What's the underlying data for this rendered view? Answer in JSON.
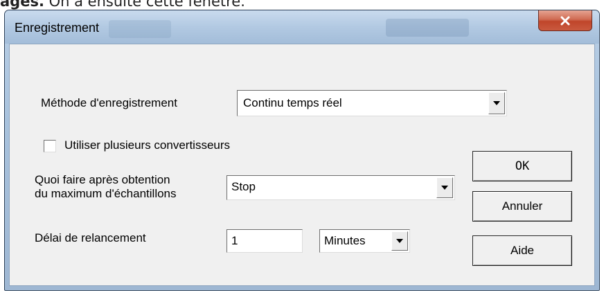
{
  "document_text": {
    "bold": "ages.",
    "rest": " On a ensuite cette fenêtre."
  },
  "window": {
    "title": "Enregistrement",
    "close_icon": "close-x-icon"
  },
  "form": {
    "method_label": "Méthode d'enregistrement",
    "method_value": "Continu temps réel",
    "multi_converters_label": "Utiliser plusieurs convertisseurs",
    "multi_converters_checked": false,
    "after_max_label_line1": "Quoi faire après obtention",
    "after_max_label_line2": "du maximum d'échantillons",
    "after_max_value": "Stop",
    "restart_delay_label": "Délai de relancement",
    "restart_delay_value": "1",
    "restart_unit_value": "Minutes"
  },
  "buttons": {
    "ok": "OK",
    "cancel": "Annuler",
    "help": "Aide"
  },
  "colors": {
    "close_button": "#c9543a",
    "title_bar": "#b2c9e2",
    "client_area": "#f0f0f0"
  }
}
